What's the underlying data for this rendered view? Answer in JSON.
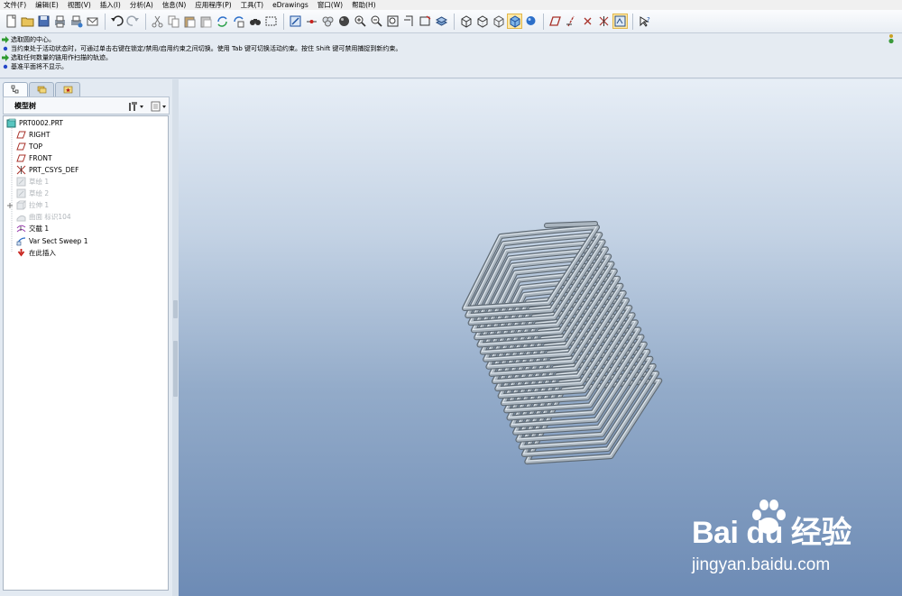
{
  "menu": [
    "文件(F)",
    "编辑(E)",
    "视图(V)",
    "插入(I)",
    "分析(A)",
    "信息(N)",
    "应用程序(P)",
    "工具(T)",
    "eDrawings",
    "窗口(W)",
    "帮助(H)"
  ],
  "messages": [
    {
      "text": "选取圆的中心。",
      "type": "prompt"
    },
    {
      "text": "当约束处于活动状态时，可通过单击右键在锁定/禁用/启用约束之间切换。使用 Tab 键可切换活动约束。按住 Shift 键可禁用捕捉到新约束。",
      "type": "info"
    },
    {
      "text": "选取任何数量的链用作扫描的轨迹。",
      "type": "prompt"
    },
    {
      "text": "基准平面将不显示。",
      "type": "info"
    }
  ],
  "tree": {
    "title": "模型树",
    "nodes": [
      {
        "label": "PRT0002.PRT",
        "icon": "part-icon",
        "dim": false
      },
      {
        "label": "RIGHT",
        "icon": "datum-plane-icon",
        "dim": false
      },
      {
        "label": "TOP",
        "icon": "datum-plane-icon",
        "dim": false
      },
      {
        "label": "FRONT",
        "icon": "datum-plane-icon",
        "dim": false
      },
      {
        "label": "PRT_CSYS_DEF",
        "icon": "coordinate-system-icon",
        "dim": false
      },
      {
        "label": "草绘 1",
        "icon": "sketch-icon",
        "dim": true
      },
      {
        "label": "草绘 2",
        "icon": "sketch-icon",
        "dim": true
      },
      {
        "label": "拉伸 1",
        "icon": "extrude-icon",
        "dim": true
      },
      {
        "label": "曲面 标识104",
        "icon": "surface-icon",
        "dim": true
      },
      {
        "label": "交截 1",
        "icon": "intersect-icon",
        "dim": false
      },
      {
        "label": "Var Sect Sweep 1",
        "icon": "sweep-icon",
        "dim": false
      },
      {
        "label": "在此插入",
        "icon": "insert-here-arrow-icon",
        "dim": false
      }
    ]
  },
  "colors": {
    "prompt_arrow": "#2f9a2f",
    "info_dot": "#2446c8",
    "plane_icon": "#a8322a",
    "insert_arrow": "#c8221c",
    "model_tube": "#aab5bf"
  },
  "watermark": {
    "logo_text": "Bai du 经验",
    "site": "jingyan.baidu.com"
  }
}
